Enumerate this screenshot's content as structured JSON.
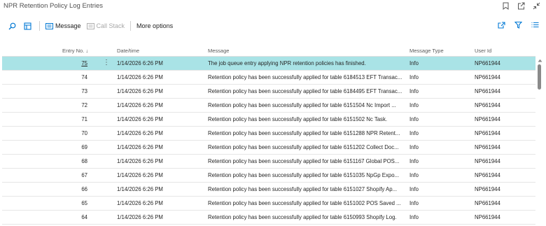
{
  "window": {
    "title": "NPR Retention Policy Log Entries"
  },
  "toolbar": {
    "message_label": "Message",
    "call_stack_label": "Call Stack",
    "more_options_label": "More options"
  },
  "columns": {
    "entry_no": "Entry No. ↓",
    "datetime": "Date/time",
    "message": "Message",
    "message_type": "Message Type",
    "user_id": "User Id"
  },
  "rows": [
    {
      "entry_no": "75",
      "datetime": "1/14/2026 6:26 PM",
      "message": "The job queue entry applying NPR retention policies has finished.",
      "type": "Info",
      "user": "NP661944"
    },
    {
      "entry_no": "74",
      "datetime": "1/14/2026 6:26 PM",
      "message": "Retention policy has been successfully applied for table 6184513 EFT Transac...",
      "type": "Info",
      "user": "NP661944"
    },
    {
      "entry_no": "73",
      "datetime": "1/14/2026 6:26 PM",
      "message": "Retention policy has been successfully applied for table 6184495 EFT Transac...",
      "type": "Info",
      "user": "NP661944"
    },
    {
      "entry_no": "72",
      "datetime": "1/14/2026 6:26 PM",
      "message": "Retention policy has been successfully applied for table 6151504 Nc Import ...",
      "type": "Info",
      "user": "NP661944"
    },
    {
      "entry_no": "71",
      "datetime": "1/14/2026 6:26 PM",
      "message": "Retention policy has been successfully applied for table 6151502 Nc Task.",
      "type": "Info",
      "user": "NP661944"
    },
    {
      "entry_no": "70",
      "datetime": "1/14/2026 6:26 PM",
      "message": "Retention policy has been successfully applied for table 6151288 NPR Retent...",
      "type": "Info",
      "user": "NP661944"
    },
    {
      "entry_no": "69",
      "datetime": "1/14/2026 6:26 PM",
      "message": "Retention policy has been successfully applied for table 6151202 Collect Doc...",
      "type": "Info",
      "user": "NP661944"
    },
    {
      "entry_no": "68",
      "datetime": "1/14/2026 6:26 PM",
      "message": "Retention policy has been successfully applied for table 6151167 Global POS...",
      "type": "Info",
      "user": "NP661944"
    },
    {
      "entry_no": "67",
      "datetime": "1/14/2026 6:26 PM",
      "message": "Retention policy has been successfully applied for table 6151035 NpGp Expo...",
      "type": "Info",
      "user": "NP661944"
    },
    {
      "entry_no": "66",
      "datetime": "1/14/2026 6:26 PM",
      "message": "Retention policy has been successfully applied for table 6151027 Shopify Ap...",
      "type": "Info",
      "user": "NP661944"
    },
    {
      "entry_no": "65",
      "datetime": "1/14/2026 6:26 PM",
      "message": "Retention policy has been successfully applied for table 6151002 POS Saved ...",
      "type": "Info",
      "user": "NP661944"
    },
    {
      "entry_no": "64",
      "datetime": "1/14/2026 6:26 PM",
      "message": "Retention policy has been successfully applied for table 6150993 Shopify Log.",
      "type": "Info",
      "user": "NP661944"
    }
  ],
  "colors": {
    "selected_row": "#a9e3e6",
    "accent": "#0078d4"
  }
}
